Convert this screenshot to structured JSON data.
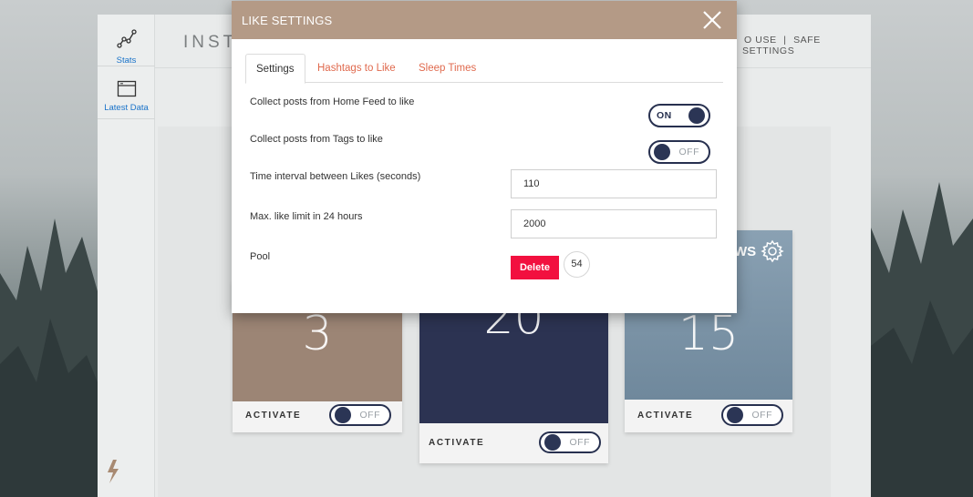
{
  "app": {
    "header_title": "INST",
    "header_links": [
      "O USE",
      "|",
      "SAFE SETTINGS"
    ]
  },
  "sidebar": {
    "items": [
      {
        "label": "Stats",
        "icon": "stats-graph-icon"
      },
      {
        "label": "Latest Data",
        "icon": "window-icon"
      }
    ],
    "bottom_icon": "lightning-icon"
  },
  "cards": [
    {
      "number": "3",
      "activate_label": "ACTIVATE",
      "toggle_text": "OFF",
      "color": "#9c8575"
    },
    {
      "number": "20",
      "activate_label": "ACTIVATE",
      "toggle_text": "OFF",
      "color": "#2c3352"
    },
    {
      "title_fragment": "WS",
      "number": "15",
      "activate_label": "ACTIVATE",
      "toggle_text": "OFF",
      "color": "#7d95a8"
    }
  ],
  "modal": {
    "title": "LIKE SETTINGS",
    "tabs": [
      {
        "label": "Settings",
        "active": true
      },
      {
        "label": "Hashtags to Like",
        "active": false
      },
      {
        "label": "Sleep Times",
        "active": false
      }
    ],
    "rows": {
      "home_feed": {
        "label": "Collect posts from Home Feed to like",
        "toggle": "ON"
      },
      "tags": {
        "label": "Collect posts from Tags to like",
        "toggle": "OFF"
      },
      "interval": {
        "label": "Time interval between Likes (seconds)",
        "value": "110"
      },
      "limit": {
        "label": "Max. like limit in 24 hours",
        "value": "2000"
      },
      "pool": {
        "label": "Pool",
        "delete_label": "Delete",
        "count": "54"
      }
    }
  },
  "colors": {
    "modal_header": "#b49a86",
    "accent_link": "#e06a4e",
    "delete": "#f2103f",
    "toggle_dark": "#27304f"
  }
}
